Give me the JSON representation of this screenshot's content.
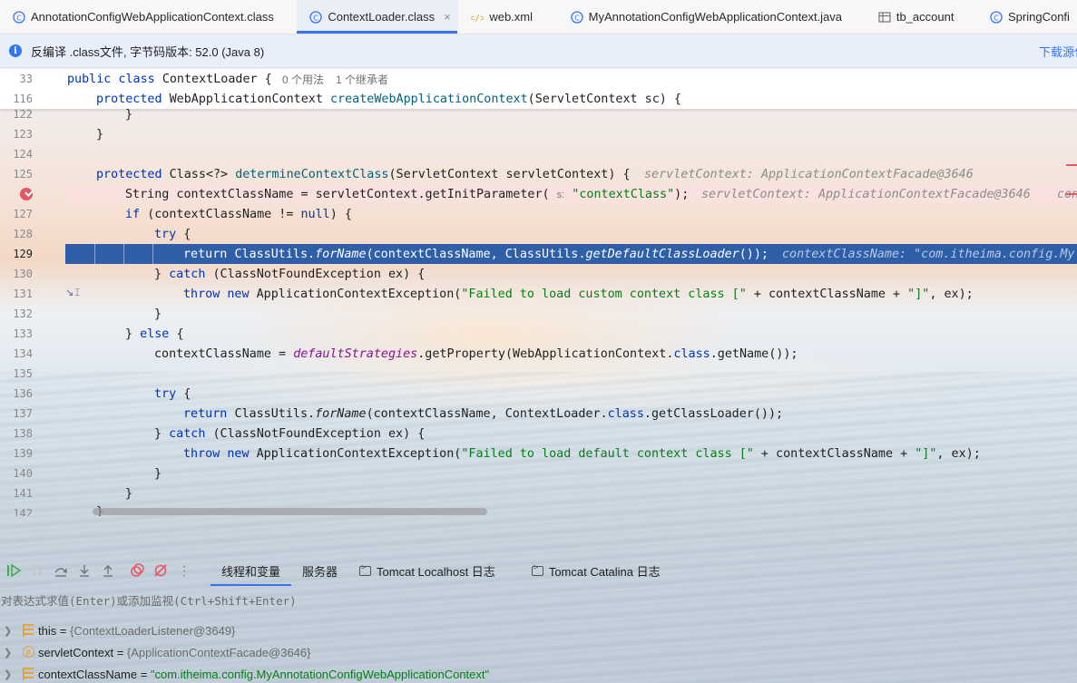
{
  "tabs": [
    {
      "label": "AnnotationConfigWebApplicationContext.class",
      "icon": "class-icon",
      "active": false
    },
    {
      "label": "ContextLoader.class",
      "icon": "class-icon",
      "active": true,
      "close": "×"
    },
    {
      "label": "web.xml",
      "icon": "xml-icon",
      "active": false
    },
    {
      "label": "MyAnnotationConfigWebApplicationContext.java",
      "icon": "class-icon",
      "active": false
    },
    {
      "label": "tb_account",
      "icon": "table-icon",
      "active": false
    },
    {
      "label": "SpringConfi",
      "icon": "class-icon",
      "active": false
    }
  ],
  "infobar": {
    "text": "反编译 .class文件, 字节码版本: 52.0 (Java 8)",
    "link": "下载源代"
  },
  "sticky": {
    "line1_num": "33",
    "line1_usage1": "0 个用法",
    "line1_usage2": "1 个继承者",
    "line2_num": "116"
  },
  "lines": {
    "l122": "122",
    "l123": "123",
    "l124": "124",
    "l125": "125",
    "l126": "126",
    "l127": "127",
    "l128": "128",
    "l129": "129",
    "l130": "130",
    "l131": "131",
    "l132": "132",
    "l133": "133",
    "l134": "134",
    "l135": "135",
    "l136": "136",
    "l137": "137",
    "l138": "138",
    "l139": "139",
    "l140": "140",
    "l141": "141",
    "l142": "142"
  },
  "hints": {
    "h125": "servletContext: ApplicationContextFacade@3646",
    "h126": "servletContext: ApplicationContextFacade@3646",
    "h126b": "con",
    "h129": "contextClassName: \"com.itheima.config.My",
    "param_s": "s:"
  },
  "strings": {
    "contextClass": "\"contextClass\"",
    "failedCustom": "\"Failed to load custom context class [\"",
    "failedDefault": "\"Failed to load default context class [\"",
    "closeBracket": "\"]\""
  },
  "debug": {
    "tabs": [
      {
        "label": "线程和变量",
        "active": true
      },
      {
        "label": "服务器",
        "active": false
      },
      {
        "label": "Tomcat Localhost 日志",
        "active": false
      },
      {
        "label": "Tomcat Catalina 日志",
        "active": false
      }
    ],
    "eval_placeholder": "对表达式求值(Enter)或添加监视(Ctrl+Shift+Enter)",
    "variables": [
      {
        "name": "this",
        "value": "{ContextLoaderListener@3649}",
        "icon": "field-icon"
      },
      {
        "name": "servletContext",
        "value": "{ApplicationContextFacade@3646}",
        "icon": "parameter-icon"
      },
      {
        "name": "contextClassName",
        "value": "\"com.itheima.config.MyAnnotationConfigWebApplicationContext\"",
        "icon": "field-icon"
      }
    ]
  },
  "colors": {
    "accent": "#3574f0",
    "exec_line": "#2f5fa8",
    "breakpoint": "#e55765",
    "keyword": "#0033b3",
    "string": "#067d17"
  }
}
